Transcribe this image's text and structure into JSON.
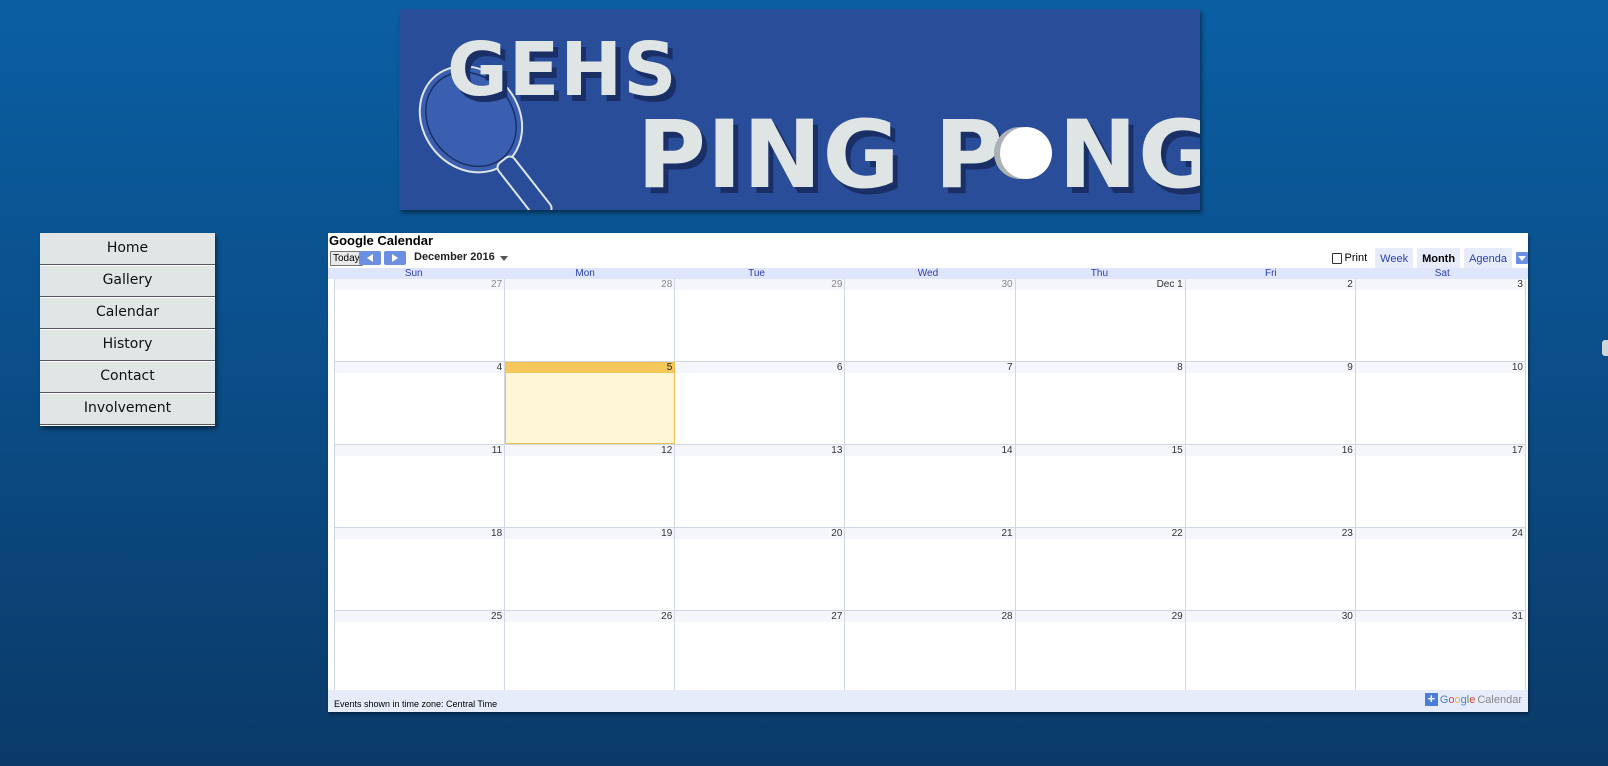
{
  "banner": {
    "line1": "GEHS",
    "line2": "PING P",
    "line3": "NG",
    "colors": {
      "background": "#2a4d99",
      "text": "#dfe5e4"
    }
  },
  "nav": {
    "items": [
      {
        "label": "Home"
      },
      {
        "label": "Gallery"
      },
      {
        "label": "Calendar"
      },
      {
        "label": "History"
      },
      {
        "label": "Contact"
      },
      {
        "label": "Involvement"
      }
    ]
  },
  "calendar": {
    "title": "Google Calendar",
    "today_label": "Today",
    "month_label": "December 2016",
    "print_label": "Print",
    "tabs": [
      {
        "label": "Week",
        "active": false
      },
      {
        "label": "Month",
        "active": true
      },
      {
        "label": "Agenda",
        "active": false
      }
    ],
    "weekdays": [
      "Sun",
      "Mon",
      "Tue",
      "Wed",
      "Thu",
      "Fri",
      "Sat"
    ],
    "weeks": [
      [
        {
          "n": "27",
          "other": true
        },
        {
          "n": "28",
          "other": true
        },
        {
          "n": "29",
          "other": true
        },
        {
          "n": "30",
          "other": true
        },
        {
          "n": "Dec 1"
        },
        {
          "n": "2"
        },
        {
          "n": "3"
        }
      ],
      [
        {
          "n": "4"
        },
        {
          "n": "5",
          "today": true
        },
        {
          "n": "6"
        },
        {
          "n": "7"
        },
        {
          "n": "8"
        },
        {
          "n": "9"
        },
        {
          "n": "10"
        }
      ],
      [
        {
          "n": "11"
        },
        {
          "n": "12"
        },
        {
          "n": "13"
        },
        {
          "n": "14"
        },
        {
          "n": "15"
        },
        {
          "n": "16"
        },
        {
          "n": "17"
        }
      ],
      [
        {
          "n": "18"
        },
        {
          "n": "19"
        },
        {
          "n": "20"
        },
        {
          "n": "21"
        },
        {
          "n": "22"
        },
        {
          "n": "23"
        },
        {
          "n": "24"
        }
      ],
      [
        {
          "n": "25"
        },
        {
          "n": "26"
        },
        {
          "n": "27"
        },
        {
          "n": "28"
        },
        {
          "n": "29"
        },
        {
          "n": "30"
        },
        {
          "n": "31"
        }
      ]
    ],
    "timezone_text": "Events shown in time zone: Central Time",
    "logo": {
      "plus": "+",
      "g1": "G",
      "g2": "o",
      "g3": "o",
      "g4": "g",
      "g5": "l",
      "g6": "e",
      "cal": "Calendar"
    },
    "colors": {
      "today_fill": "#fff6d6",
      "today_header": "#f6c75a",
      "accent": "#6c8fe4",
      "weekday_text": "#2a3fb0"
    }
  }
}
